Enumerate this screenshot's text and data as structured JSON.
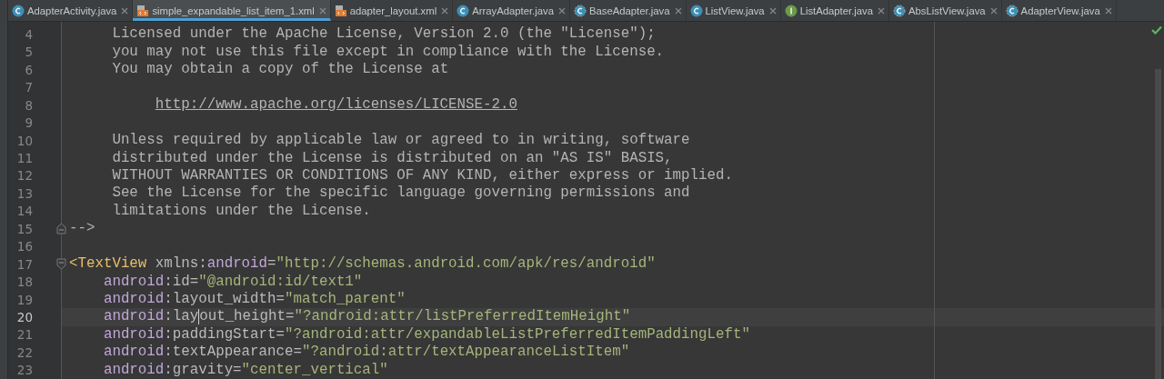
{
  "tabs": [
    {
      "label": "AdapterActivity.java",
      "kind": "class",
      "selected": false
    },
    {
      "label": "simple_expandable_list_item_1.xml",
      "kind": "xml",
      "selected": true
    },
    {
      "label": "adapter_layout.xml",
      "kind": "xml",
      "selected": false
    },
    {
      "label": "ArrayAdapter.java",
      "kind": "class",
      "selected": false
    },
    {
      "label": "BaseAdapter.java",
      "kind": "abstract",
      "selected": false
    },
    {
      "label": "ListView.java",
      "kind": "class",
      "selected": false
    },
    {
      "label": "ListAdapter.java",
      "kind": "interface",
      "selected": false
    },
    {
      "label": "AbsListView.java",
      "kind": "abstract",
      "selected": false
    },
    {
      "label": "AdapterView.java",
      "kind": "abstract",
      "selected": false
    }
  ],
  "editor": {
    "lines": [
      {
        "number": "4",
        "current": false,
        "tokens": [
          {
            "kind": "comment",
            "text": "     Licensed under the Apache License, Version 2.0 (the \"License\");"
          }
        ]
      },
      {
        "number": "5",
        "current": false,
        "tokens": [
          {
            "kind": "comment",
            "text": "     you may not use this file except in compliance with the License."
          }
        ]
      },
      {
        "number": "6",
        "current": false,
        "tokens": [
          {
            "kind": "comment",
            "text": "     You may obtain a copy of the License at"
          }
        ]
      },
      {
        "number": "7",
        "current": false
      },
      {
        "number": "8",
        "current": false,
        "tokens": [
          {
            "kind": "link",
            "text": "http://www.apache.org/licenses/LICENSE-2.0"
          }
        ]
      },
      {
        "number": "9",
        "current": false
      },
      {
        "number": "10",
        "current": false,
        "tokens": [
          {
            "kind": "comment",
            "text": "     Unless required by applicable law or agreed to in writing, software"
          }
        ]
      },
      {
        "number": "11",
        "current": false,
        "tokens": [
          {
            "kind": "comment",
            "text": "     distributed under the License is distributed on an \"AS IS\" BASIS,"
          }
        ]
      },
      {
        "number": "12",
        "current": false,
        "tokens": [
          {
            "kind": "comment",
            "text": "     WITHOUT WARRANTIES OR CONDITIONS OF ANY KIND, either express or implied."
          }
        ]
      },
      {
        "number": "13",
        "current": false,
        "tokens": [
          {
            "kind": "comment",
            "text": "     See the License for the specific language governing permissions and"
          }
        ]
      },
      {
        "number": "14",
        "current": false,
        "tokens": [
          {
            "kind": "comment",
            "text": "     limitations under the License."
          }
        ]
      },
      {
        "number": "15",
        "current": false,
        "fold_end": true,
        "tokens": [
          {
            "kind": "comment",
            "text": "-->"
          }
        ]
      },
      {
        "number": "16",
        "current": false
      },
      {
        "number": "17",
        "current": false,
        "fold_start": true,
        "tokens": [
          {
            "kind": "tag",
            "text": "<TextView"
          },
          {
            "kind": "plain",
            "text": " xmlns:"
          },
          {
            "kind": "ns",
            "text": "android"
          },
          {
            "kind": "plain",
            "text": "="
          },
          {
            "kind": "value",
            "text": "\"http://schemas.android.com/apk/res/android\""
          }
        ]
      },
      {
        "number": "18",
        "current": false,
        "tokens": [
          {
            "kind": "ns",
            "text": "    android"
          },
          {
            "kind": "plain",
            "text": ":id="
          },
          {
            "kind": "value",
            "text": "\"@android:id/text1\""
          }
        ]
      },
      {
        "number": "19",
        "current": false,
        "tokens": [
          {
            "kind": "ns",
            "text": "    android"
          },
          {
            "kind": "plain",
            "text": ":layout_width="
          },
          {
            "kind": "value",
            "text": "\"match_parent\""
          }
        ]
      },
      {
        "number": "20",
        "current": true,
        "tokens": [
          {
            "kind": "ns",
            "text": "    android"
          },
          {
            "kind": "plain",
            "text": ":lay"
          },
          {
            "kind": "caret"
          },
          {
            "kind": "plain",
            "text": "out_height="
          },
          {
            "kind": "value",
            "text": "\"?android:attr/listPreferredItemHeight\""
          }
        ]
      },
      {
        "number": "21",
        "current": false,
        "tokens": [
          {
            "kind": "ns",
            "text": "    android"
          },
          {
            "kind": "plain",
            "text": ":paddingStart="
          },
          {
            "kind": "value",
            "text": "\"?android:attr/expandableListPreferredItemPaddingLeft\""
          }
        ]
      },
      {
        "number": "22",
        "current": false,
        "tokens": [
          {
            "kind": "ns",
            "text": "    android"
          },
          {
            "kind": "plain",
            "text": ":textAppearance="
          },
          {
            "kind": "value",
            "text": "\"?android:attr/textAppearanceListItem\""
          }
        ]
      },
      {
        "number": "23",
        "current": false,
        "tokens": [
          {
            "kind": "ns",
            "text": "    android"
          },
          {
            "kind": "plain",
            "text": ":gravity="
          },
          {
            "kind": "value",
            "text": "\"center_vertical\""
          }
        ]
      }
    ]
  }
}
